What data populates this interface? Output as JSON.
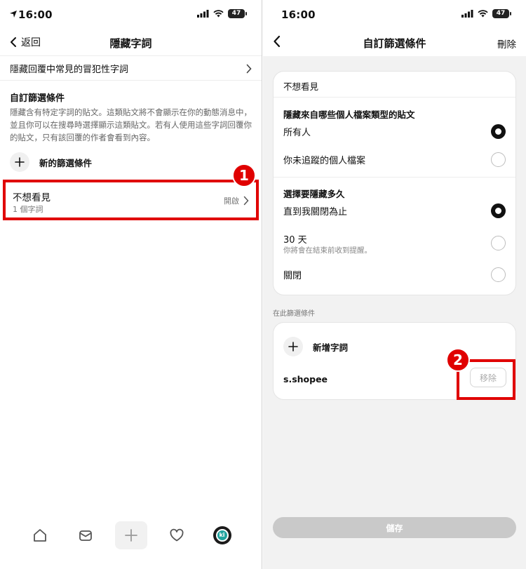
{
  "left_screen": {
    "status_time": "16:00",
    "battery": "47",
    "back_label": "返回",
    "title": "隱藏字詞",
    "link_row_label": "隱藏回覆中常見的冒犯性字詞",
    "custom_section_title": "自訂篩選條件",
    "custom_section_desc": "隱藏含有特定字詞的貼文。這類貼文將不會顯示在你的動態消息中，並且你可以在搜尋時選擇顯示這類貼文。若有人使用這些字詞回覆你的貼文，只有該回覆的作者會看到內容。",
    "new_filter_label": "新的篩選條件",
    "filter": {
      "name": "不想看見",
      "word_count": "1 個字詞",
      "status": "開啟"
    },
    "marker": "1",
    "tabs": [
      "home-icon",
      "inbox-icon",
      "plus-icon",
      "heart-icon",
      "avatar"
    ]
  },
  "right_screen": {
    "status_time": "16:00",
    "battery": "47",
    "title": "自訂篩選條件",
    "delete_label": "刪除",
    "filter_name": "不想看見",
    "profile_type_heading": "隱藏來自哪些個人檔案類型的貼文",
    "profile_options": [
      {
        "label": "所有人",
        "selected": true
      },
      {
        "label": "你未追蹤的個人檔案",
        "selected": false
      }
    ],
    "duration_heading": "選擇要隱藏多久",
    "duration_options": [
      {
        "label": "直到我關閉為止",
        "selected": true
      },
      {
        "label": "30 天",
        "sub": "你將會在結束前收到提醒。",
        "selected": false
      },
      {
        "label": "關閉",
        "selected": false
      }
    ],
    "words_section_label": "在此篩選條件",
    "add_word_label": "新增字詞",
    "word": "s.shopee",
    "remove_label": "移除",
    "marker": "2",
    "save_label": "儲存"
  },
  "colors": {
    "highlight": "#e00000",
    "save_disabled": "#c9c9c9",
    "right_background": "#f2f2f2"
  }
}
